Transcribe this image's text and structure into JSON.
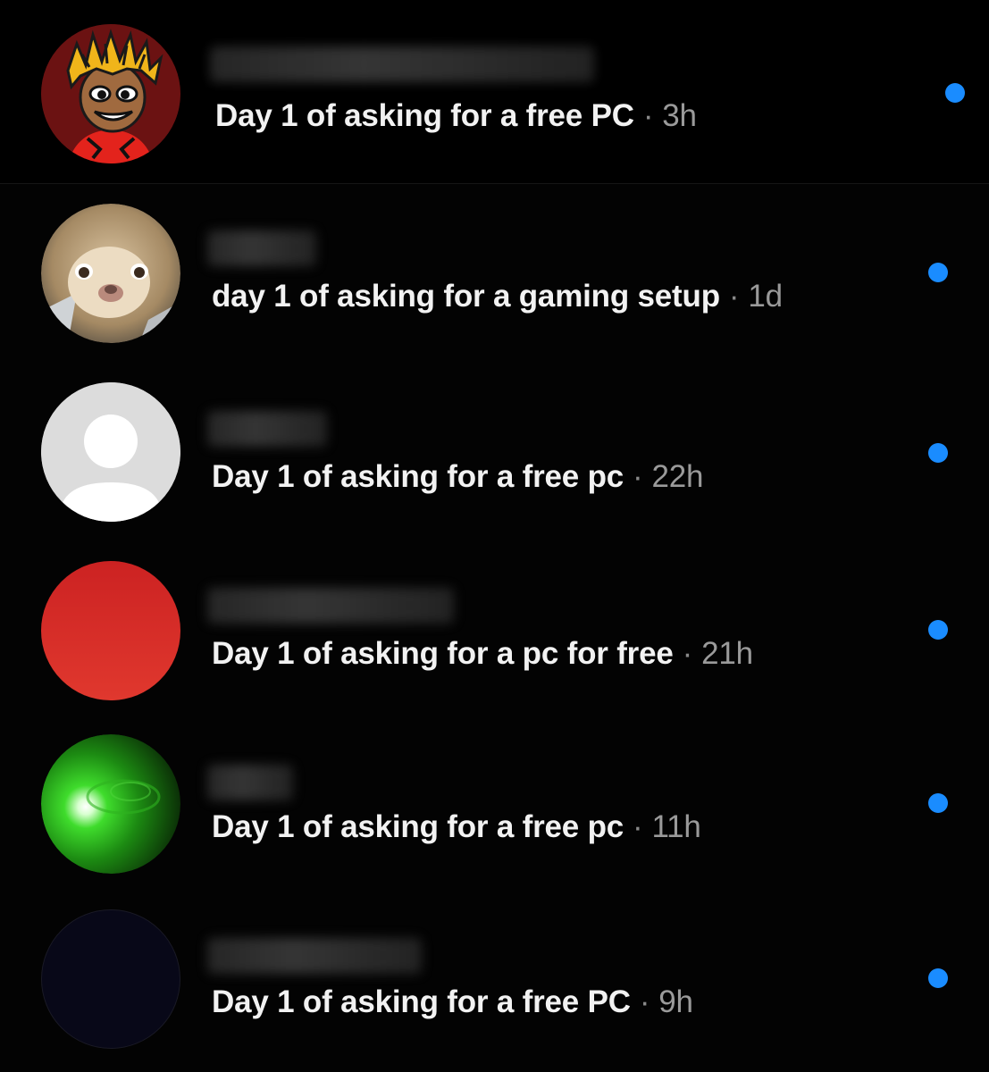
{
  "accent_color": "#1a8cff",
  "messages": [
    {
      "text": "Day 1 of asking for a free PC",
      "separator": "·",
      "time": "3h",
      "avatar_icon": "cartoon-avatar-icon",
      "unread": true
    },
    {
      "text": "day 1 of asking for a gaming setup",
      "separator": "·",
      "time": "1d",
      "avatar_icon": "cat-photo-avatar-icon",
      "unread": true
    },
    {
      "text": "Day 1 of asking for a free pc",
      "separator": "·",
      "time": "22h",
      "avatar_icon": "default-user-avatar-icon",
      "unread": true
    },
    {
      "text": "Day 1 of asking for a pc for free",
      "separator": "·",
      "time": "21h",
      "avatar_icon": "red-avatar-icon",
      "unread": true
    },
    {
      "text": "Day 1 of asking for a free pc",
      "separator": "·",
      "time": "11h",
      "avatar_icon": "green-light-avatar-icon",
      "unread": true
    },
    {
      "text": "Day 1 of asking for a free PC",
      "separator": "·",
      "time": "9h",
      "avatar_icon": "dark-avatar-icon",
      "unread": true
    }
  ]
}
